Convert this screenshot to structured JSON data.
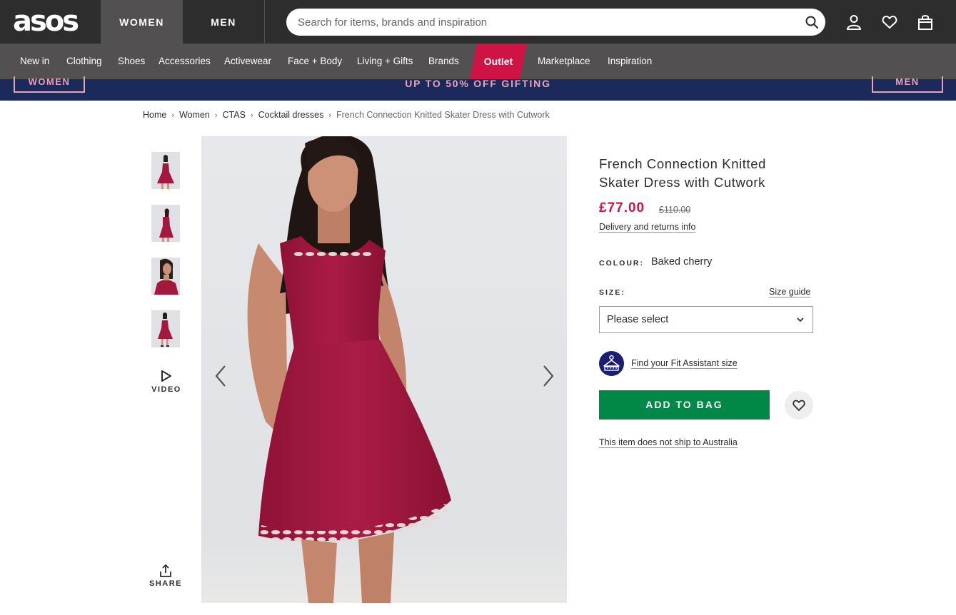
{
  "header": {
    "logo": "asos",
    "tabs": [
      {
        "label": "WOMEN",
        "active": true
      },
      {
        "label": "MEN",
        "active": false
      }
    ],
    "search_placeholder": "Search for items, brands and inspiration",
    "icons": [
      "search-icon",
      "account-icon",
      "saved-items-icon",
      "bag-icon"
    ]
  },
  "nav": {
    "items": [
      "New in",
      "Clothing",
      "Shoes",
      "Accessories",
      "Activewear",
      "Face + Body",
      "Living + Gifts",
      "Brands",
      "Outlet",
      "Marketplace",
      "Inspiration"
    ],
    "outlet_color": "#d01345"
  },
  "promo": {
    "text": "UP TO 50% OFF GIFTING",
    "left_button": "WOMEN",
    "right_button": "MEN"
  },
  "breadcrumb": [
    "Home",
    "Women",
    "CTAS",
    "Cocktail dresses",
    "French Connection Knitted Skater Dress with Cutwork"
  ],
  "gallery": {
    "thumbnail_count": 4,
    "video_label": "VIDEO",
    "share_label": "SHARE"
  },
  "product": {
    "title_line1": "French Connection Knitted",
    "title_line2": "Skater Dress with Cutwork",
    "price": "£77.00",
    "old_price": "£110.00",
    "delivery_link": "Delivery and returns info",
    "colour_label": "COLOUR:",
    "colour_value": "Baked cherry",
    "size_label": "SIZE:",
    "size_guide": "Size guide",
    "size_select": "Please select",
    "fit_assistant": "Find your Fit Assistant size",
    "add_to_bag": "ADD TO BAG",
    "shipping_note": "This item does not ship to Australia"
  },
  "colors": {
    "header_bg": "#2d2d2d",
    "nav_bg": "#525050",
    "promo_bg": "#1c2a5b",
    "promo_text": "#e8a3b7",
    "price": "#d01345",
    "add_to_bag": "#018849",
    "dress": "#a3183f"
  }
}
